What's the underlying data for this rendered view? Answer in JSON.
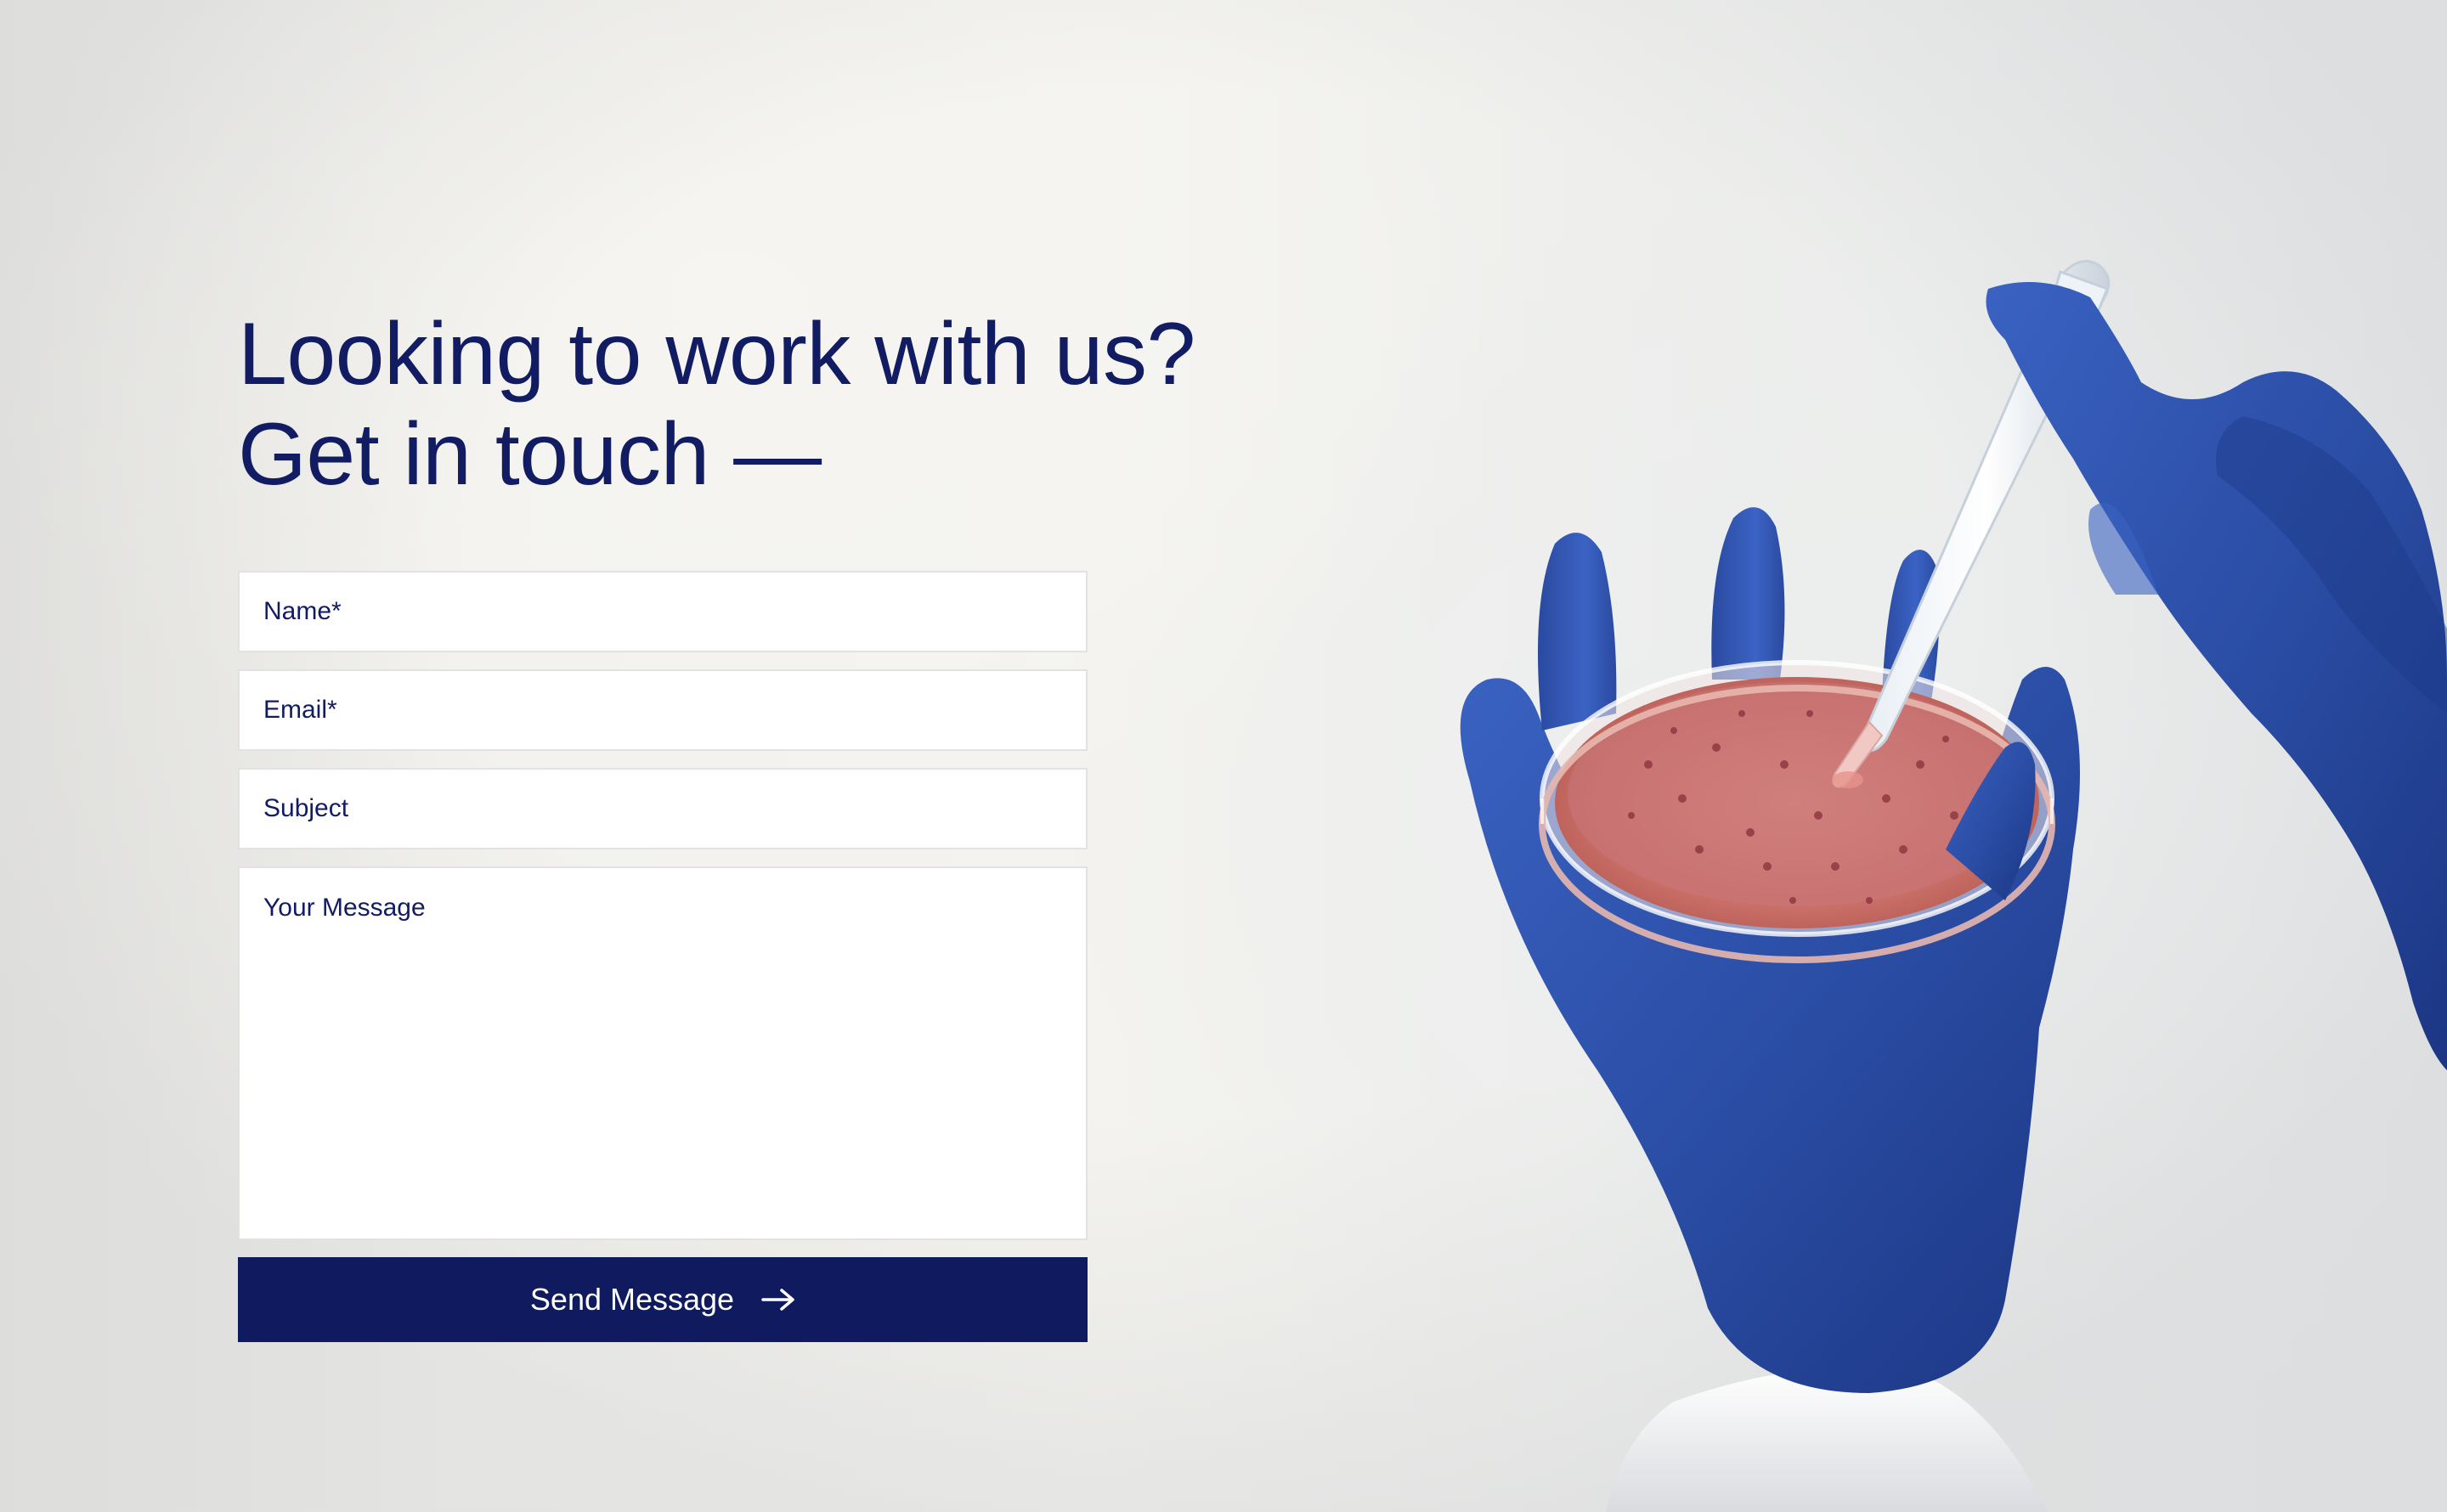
{
  "contact": {
    "heading_line1": "Looking to work with us?",
    "heading_line2": "Get in touch —",
    "form": {
      "name_placeholder": "Name*",
      "email_placeholder": "Email*",
      "subject_placeholder": "Subject",
      "message_placeholder": "Your Message",
      "submit_label": "Send Message",
      "submit_icon": "arrow-right-icon"
    }
  },
  "colors": {
    "brand_navy": "#0f1b5e",
    "heading_text": "#111c62",
    "glove_blue": "#2c4fa6",
    "background": "#f2f1ed"
  },
  "image": {
    "subject": "gloved-hands-petri-dish-pipette"
  }
}
